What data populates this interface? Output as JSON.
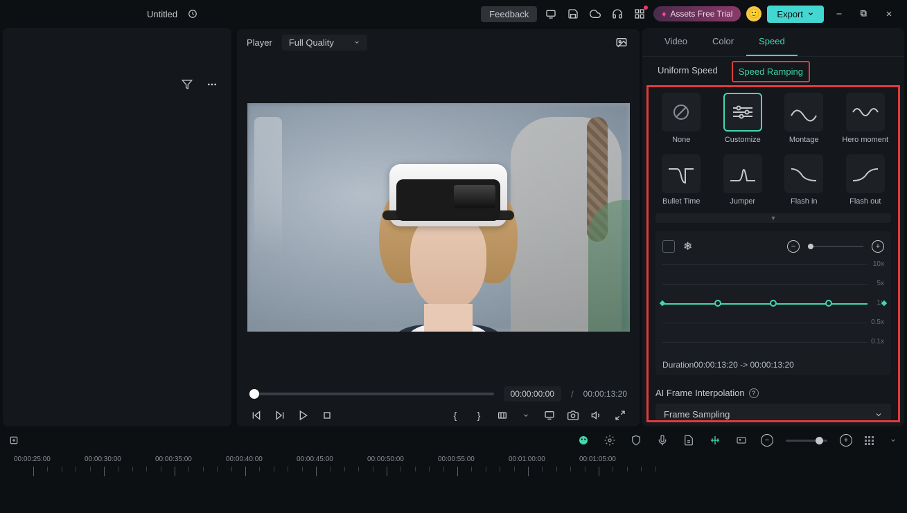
{
  "topbar": {
    "title": "Untitled",
    "feedback": "Feedback",
    "assets_trial": "Assets Free Trial",
    "export": "Export"
  },
  "player": {
    "label": "Player",
    "quality": "Full Quality",
    "current_time": "00:00:00:00",
    "sep": "/",
    "total_time": "00:00:13:20"
  },
  "tabs": {
    "video": "Video",
    "color": "Color",
    "speed": "Speed"
  },
  "subtabs": {
    "uniform": "Uniform Speed",
    "ramping": "Speed Ramping"
  },
  "presets": [
    {
      "key": "none",
      "label": "None"
    },
    {
      "key": "customize",
      "label": "Customize"
    },
    {
      "key": "montage",
      "label": "Montage"
    },
    {
      "key": "hero",
      "label": "Hero moment"
    },
    {
      "key": "bullet",
      "label": "Bullet Time"
    },
    {
      "key": "jumper",
      "label": "Jumper"
    },
    {
      "key": "flashin",
      "label": "Flash in"
    },
    {
      "key": "flashout",
      "label": "Flash out"
    }
  ],
  "graph": {
    "scales": [
      "10x",
      "5x",
      "1x",
      "0.5x",
      "0.1x"
    ],
    "duration_label": "Duration",
    "duration_from": "00:00:13:20",
    "duration_arrow": " -> ",
    "duration_to": "00:00:13:20"
  },
  "ai": {
    "label": "AI Frame Interpolation",
    "value": "Frame Sampling"
  },
  "timeline": {
    "marks": [
      "00:00:25:00",
      "00:00:30:00",
      "00:00:35:00",
      "00:00:40:00",
      "00:00:45:00",
      "00:00:50:00",
      "00:00:55:00",
      "00:01:00:00",
      "00:01:05:00"
    ]
  }
}
